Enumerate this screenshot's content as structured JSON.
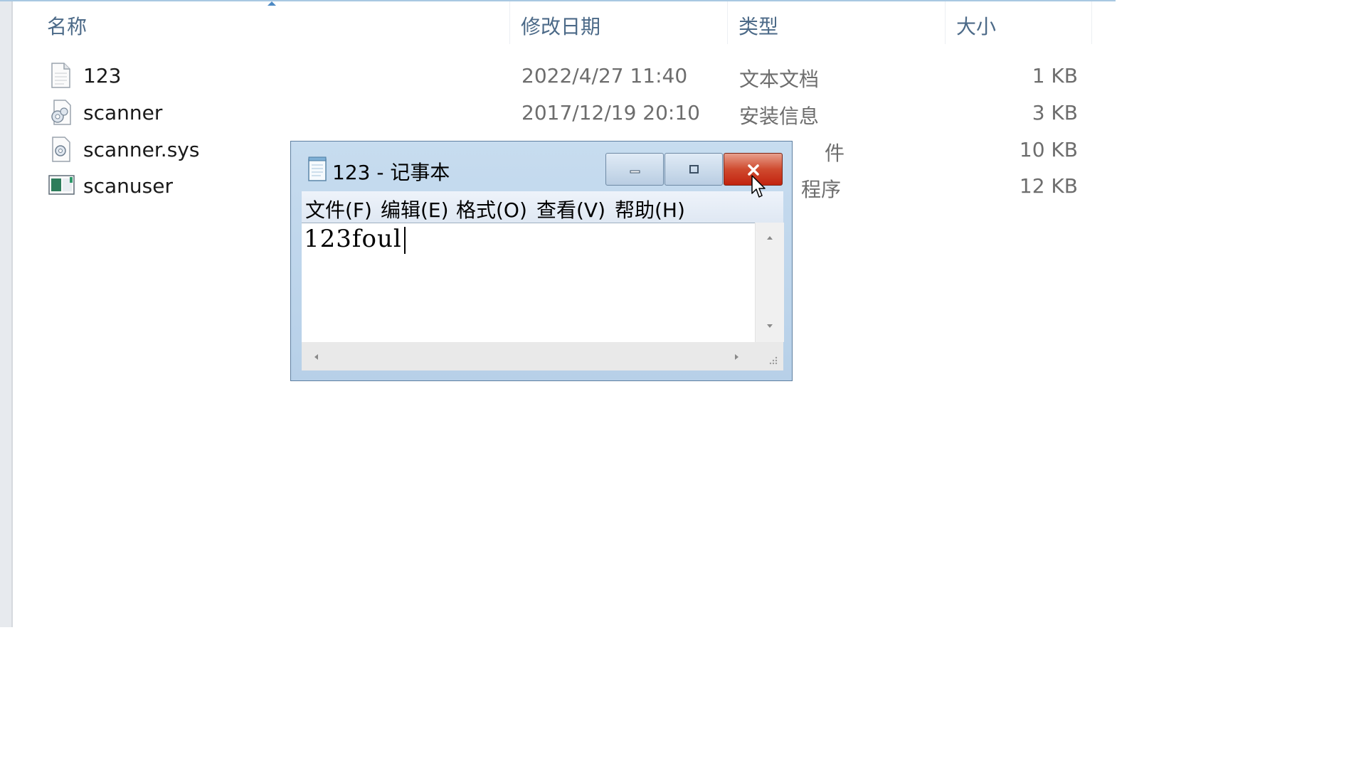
{
  "columns": {
    "name": "名称",
    "date": "修改日期",
    "type": "类型",
    "size": "大小"
  },
  "files": [
    {
      "name": "123",
      "date": "2022/4/27 11:40",
      "type": "文本文档",
      "size": "1 KB",
      "icon": "text-file-icon"
    },
    {
      "name": "scanner",
      "date": "2017/12/19 20:10",
      "type": "安装信息",
      "size": "3 KB",
      "icon": "setup-info-icon"
    },
    {
      "name": "scanner.sys",
      "date": "",
      "type": "件",
      "size": "10 KB",
      "icon": "system-file-icon"
    },
    {
      "name": "scanuser",
      "date": "",
      "type": "程序",
      "size": "12 KB",
      "icon": "application-icon"
    }
  ],
  "notepad": {
    "title": "123 - 记事本",
    "menu": [
      "文件(F)",
      "编辑(E)",
      "格式(O)",
      "查看(V)",
      "帮助(H)"
    ],
    "content": "123foul"
  }
}
